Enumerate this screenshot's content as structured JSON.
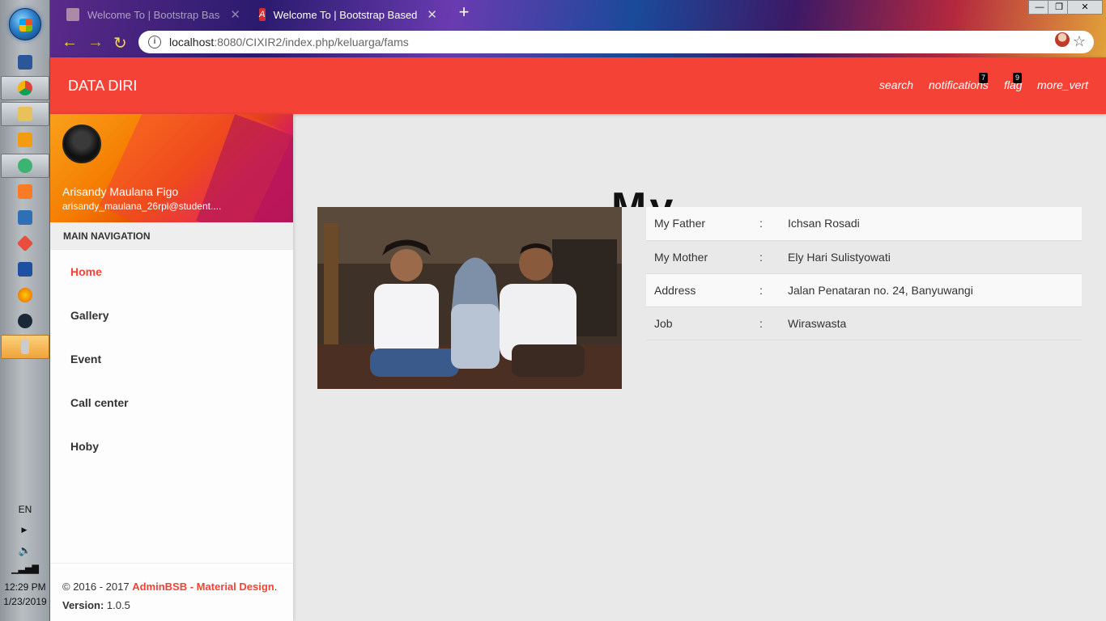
{
  "browser": {
    "tabs": [
      {
        "title": "Welcome To | Bootstrap Based ..."
      },
      {
        "title": "Welcome To | Bootstrap Based"
      }
    ],
    "url_host": "localhost",
    "url_path": ":8080/CIXIR2/index.php/keluarga/fams"
  },
  "header": {
    "brand": "DATA DIRI",
    "links": [
      {
        "label": "search"
      },
      {
        "label": "notifications",
        "badge": "7"
      },
      {
        "label": "flag",
        "badge": "9"
      },
      {
        "label": "more_vert"
      }
    ]
  },
  "sidebar": {
    "user_name": "Arisandy Maulana Figo",
    "user_email": "arisandy_maulana_26rpl@student....",
    "nav_header": "MAIN NAVIGATION",
    "menu": [
      {
        "label": "Home",
        "active": true
      },
      {
        "label": "Gallery"
      },
      {
        "label": "Event"
      },
      {
        "label": "Call center"
      },
      {
        "label": "Hoby"
      }
    ],
    "legal": {
      "copyright": "© 2016 - 2017 ",
      "brand": "AdminBSB - Material Design",
      "period": ".",
      "version_label": "Version:",
      "version": " 1.0.5"
    }
  },
  "content": {
    "title": "My Family",
    "rows": [
      {
        "key": "My Father",
        "sep": ":",
        "value": "Ichsan Rosadi"
      },
      {
        "key": "My Mother",
        "sep": ":",
        "value": "Ely Hari Sulistyowati"
      },
      {
        "key": "Address",
        "sep": ":",
        "value": "Jalan Penataran no. 24, Banyuwangi"
      },
      {
        "key": "Job",
        "sep": ":",
        "value": "Wiraswasta"
      }
    ]
  },
  "taskbar": {
    "lang": "EN",
    "time": "12:29 PM",
    "date": "1/23/2019"
  },
  "colors": {
    "accent": "#f44336"
  }
}
